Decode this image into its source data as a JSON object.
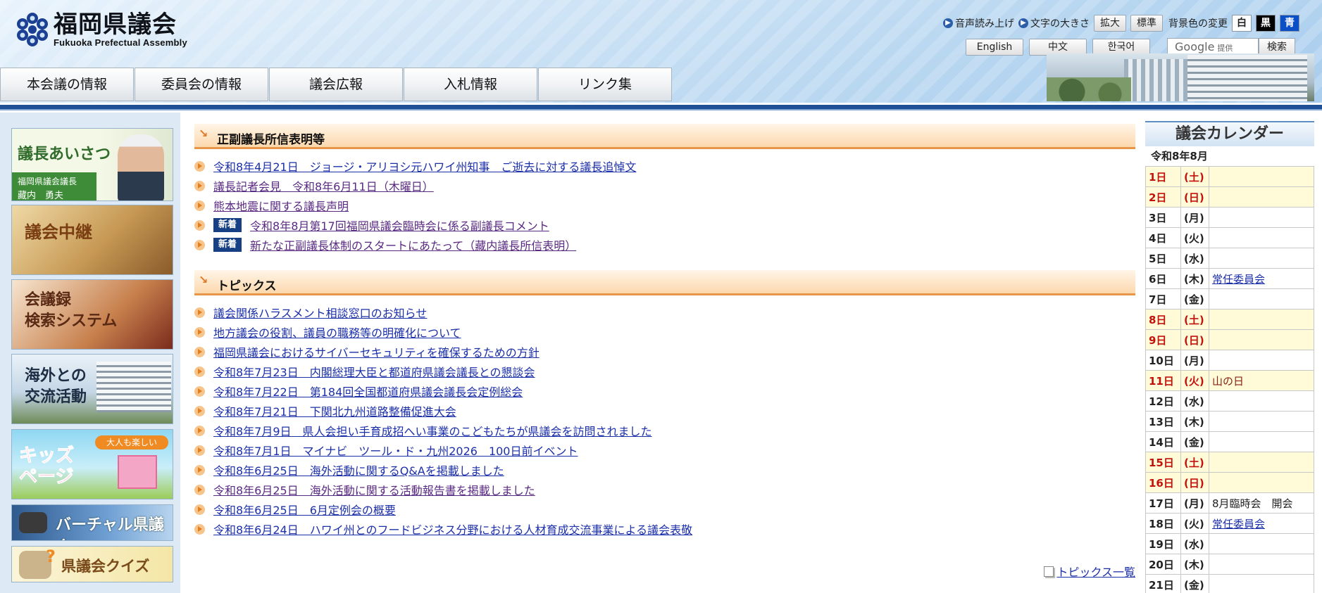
{
  "header": {
    "logo_title": "福岡県議会",
    "logo_subtitle": "Fukuoka Prefectual Assembly",
    "speech_label": "音声読み上げ",
    "fontsize_label": "文字の大きさ",
    "enlarge_label": "拡大",
    "standard_label": "標準",
    "bgcolor_label": "背景色の変更",
    "bg_white": "白",
    "bg_black": "黒",
    "bg_blue": "青",
    "lang_english": "English",
    "lang_chinese": "中文",
    "lang_korean": "한국어",
    "google_placeholder": "Google",
    "google_provided": "提供",
    "search_label": "検索"
  },
  "nav": {
    "items": [
      "本会議の情報",
      "委員会の情報",
      "議会広報",
      "入札情報",
      "リンク集"
    ]
  },
  "banners": {
    "chair_title": "議長あいさつ",
    "chair_role": "福岡県議会議長",
    "chair_name": "藏内　勇夫",
    "live": "議会中継",
    "minutes_line1": "会議録",
    "minutes_line2": "検索システム",
    "intl_line1": "海外との",
    "intl_line2": "交流活動",
    "kids_tag": "大人も楽しい",
    "kids_line1": "キッズ",
    "kids_line2": "ページ",
    "virtual": "バーチャル県議会",
    "quiz": "県議会クイズ"
  },
  "statements": {
    "title": "正副議長所信表明等",
    "new_badge": "新着",
    "items": [
      {
        "text": "令和8年4月21日　ジョージ・アリヨシ元ハワイ州知事　ご逝去に対する議長追悼文",
        "is_new": false
      },
      {
        "text": "議長記者会見　令和8年6月11日（木曜日）",
        "is_new": false
      },
      {
        "text": "熊本地震に関する議長声明",
        "is_new": false
      },
      {
        "text": "令和8年8月第17回福岡県議会臨時会に係る副議長コメント",
        "is_new": true
      },
      {
        "text": "新たな正副議長体制のスタートにあたって（藏内議長所信表明）",
        "is_new": true
      }
    ]
  },
  "topics": {
    "title": "トピックス",
    "items": [
      "議会関係ハラスメント相談窓口のお知らせ",
      "地方議会の役割、議員の職務等の明確化について",
      "福岡県議会におけるサイバーセキュリティを確保するための方針",
      "令和8年7月23日　内閣総理大臣と都道府県議会議長との懇談会",
      "令和8年7月22日　第184回全国都道府県議会議長会定例総会",
      "令和8年7月21日　下関北九州道路整備促進大会",
      "令和8年7月9日　県人会担い手育成招へい事業のこどもたちが県議会を訪問されました",
      "令和8年7月1日　マイナビ　ツール・ド・九州2026　100日前イベント",
      "令和8年6月25日　海外活動に関するQ&Aを掲載しました",
      "令和8年6月25日　海外活動に関する活動報告書を掲載しました",
      "令和8年6月25日　6月定例会の概要",
      "令和8年6月24日　ハワイ州とのフードビジネス分野における人材育成交流事業による議会表敬"
    ],
    "more_label": "トピックス一覧"
  },
  "calendar": {
    "title": "議会カレンダー",
    "month": "令和8年8月",
    "days": [
      {
        "day": "1日",
        "weekday": "(土)",
        "event": "",
        "holiday": true,
        "link": false
      },
      {
        "day": "2日",
        "weekday": "(日)",
        "event": "",
        "holiday": true,
        "link": false
      },
      {
        "day": "3日",
        "weekday": "(月)",
        "event": "",
        "holiday": false,
        "link": false
      },
      {
        "day": "4日",
        "weekday": "(火)",
        "event": "",
        "holiday": false,
        "link": false
      },
      {
        "day": "5日",
        "weekday": "(水)",
        "event": "",
        "holiday": false,
        "link": false
      },
      {
        "day": "6日",
        "weekday": "(木)",
        "event": "常任委員会",
        "holiday": false,
        "link": true
      },
      {
        "day": "7日",
        "weekday": "(金)",
        "event": "",
        "holiday": false,
        "link": false
      },
      {
        "day": "8日",
        "weekday": "(土)",
        "event": "",
        "holiday": true,
        "link": false
      },
      {
        "day": "9日",
        "weekday": "(日)",
        "event": "",
        "holiday": true,
        "link": false
      },
      {
        "day": "10日",
        "weekday": "(月)",
        "event": "",
        "holiday": false,
        "link": false
      },
      {
        "day": "11日",
        "weekday": "(火)",
        "event": "山の日",
        "holiday": true,
        "link": false
      },
      {
        "day": "12日",
        "weekday": "(水)",
        "event": "",
        "holiday": false,
        "link": false
      },
      {
        "day": "13日",
        "weekday": "(木)",
        "event": "",
        "holiday": false,
        "link": false
      },
      {
        "day": "14日",
        "weekday": "(金)",
        "event": "",
        "holiday": false,
        "link": false
      },
      {
        "day": "15日",
        "weekday": "(土)",
        "event": "",
        "holiday": true,
        "link": false
      },
      {
        "day": "16日",
        "weekday": "(日)",
        "event": "",
        "holiday": true,
        "link": false
      },
      {
        "day": "17日",
        "weekday": "(月)",
        "event": "8月臨時会　開会",
        "holiday": false,
        "link": false
      },
      {
        "day": "18日",
        "weekday": "(火)",
        "event": "常任委員会",
        "holiday": false,
        "link": true
      },
      {
        "day": "19日",
        "weekday": "(水)",
        "event": "",
        "holiday": false,
        "link": false
      },
      {
        "day": "20日",
        "weekday": "(木)",
        "event": "",
        "holiday": false,
        "link": false
      },
      {
        "day": "21日",
        "weekday": "(金)",
        "event": "",
        "holiday": false,
        "link": false
      }
    ]
  },
  "colors": {
    "nav_bar": "#1f4f94",
    "section_accent": "#e8974a",
    "new_badge": "#173f84",
    "holiday_bg": "#fffbd8",
    "holiday_text": "#c3120c",
    "link": "#1b2fa8"
  }
}
